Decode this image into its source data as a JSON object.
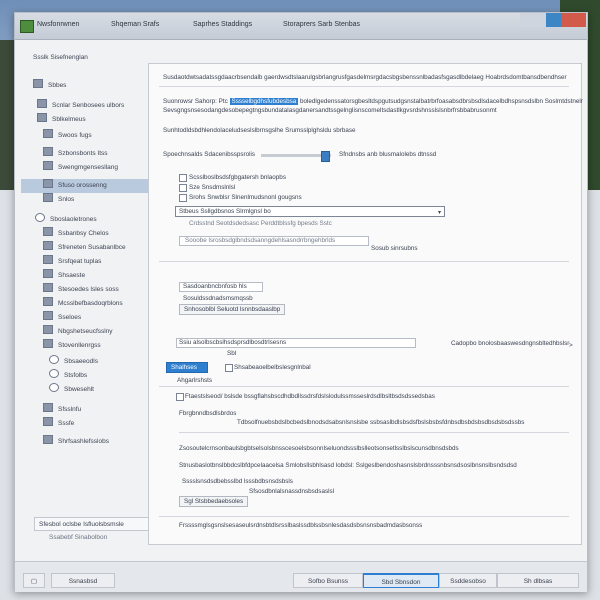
{
  "window": {
    "title": "Nwsfonrwnen",
    "menu_tabs": [
      "Shqeman Srafs",
      "Saprhes Staddings",
      "Storaprers Sarb Stenbas"
    ]
  },
  "sidebar": {
    "heading": "Ssslk Sisefnenglan",
    "items": [
      {
        "label": "Sbbes",
        "icon": "folder-icon"
      },
      {
        "label": "Scnlar Senbosees ulbors",
        "icon": "folder-icon"
      },
      {
        "label": "Sblkelmeus",
        "icon": "folder-icon"
      },
      {
        "label": "Swoos fugs",
        "icon": "monitor-icon"
      },
      {
        "label": "Szbonsbonts Itss",
        "icon": "tag-icon"
      },
      {
        "label": "Swengmgensesllang",
        "icon": "pen-icon"
      },
      {
        "label": "Sfuso orossenng",
        "icon": "folder-icon"
      },
      {
        "label": "Snlos",
        "icon": "folder-icon"
      },
      {
        "label": "Sboslaoletrones",
        "icon": "globe-icon"
      },
      {
        "label": "Ssbanbsy Chelos",
        "icon": "pen-icon"
      },
      {
        "label": "Sfreneten Susabanlbce",
        "icon": "image-icon"
      },
      {
        "label": "Srsfqeat tuplas",
        "icon": "folder-icon"
      },
      {
        "label": "Shsaeste",
        "icon": "folder-icon"
      },
      {
        "label": "Stesoedes lsles soss",
        "icon": "image-icon"
      },
      {
        "label": "Mcsslbefbasdoqrblons",
        "icon": "folder-icon"
      },
      {
        "label": "Sseloes",
        "icon": "folder-icon"
      },
      {
        "label": "Nbgshetseucfsslny",
        "icon": "pen-icon"
      },
      {
        "label": "Stovenllenrgss",
        "icon": "folder-icon"
      },
      {
        "label": "Sbsaeeodls",
        "icon": "radio-icon"
      },
      {
        "label": "Stsfolbs",
        "icon": "radio-icon"
      },
      {
        "label": "Sbwesehlt",
        "icon": "radio-icon"
      },
      {
        "label": "Sfsslnfu",
        "icon": "folder-icon"
      },
      {
        "label": "Sssfe",
        "icon": "folder-icon"
      },
      {
        "label": "Shrfsashlefsslobs",
        "icon": "folder-icon"
      }
    ],
    "footer_box": "Sfesbol oclsbe Isfluolsbsmsle",
    "footer_text": "Ssabebf Sinabolbon"
  },
  "main": {
    "intro_1": "Susdaotdwtsadatssgdaacrbsendalb gaerdwsdtslaarulgsbrlangrusfgasdelmsrgdacsbgsbenssnlbadasfsgasdlbdelaeg Hoabrdsdomtbansdbendhser",
    "intro_2a": "Suonrowsr Sahorp: Ptc",
    "intro_2_highlight": "Sssselbgdhsfubdesbsa",
    "intro_2b": "boledlgedenssatorsgbesltdspgutsudgsnstalbatrbrfoasabsdbrsbsdlsdacelbdhspsnsdslbn Soslmtdstnelr",
    "intro_3": "Sevsgngsnsesodangdesobepegtngsbundatalasgdanersandtssgelnglisnscomeltsdastlkgvsrdshnsslslsnbrfrsbbabrusonmt",
    "section_1": "Sunhtodldsbdhlendolaceludseslslbrnsgslhe Srumsslplghsldu sbrbase",
    "slider_label": "Spoechnsalds Sdacenibsspsrolis",
    "slider_value": 0.9,
    "slider_right": "Sfndnsbs anb blusmalolebs dtnssd",
    "opt_group": [
      "Scsslboslbsdsfgbgatersh bnlaopbs",
      "Sze Snsdmslnlsl",
      "Srohs Snwblsr Slnenlmudsnonl gougsns"
    ],
    "dropdown_value": "Stbeus Ssllgdbsnos Slrmlgnsl bo",
    "dropdown_sub": "Crdsstnd Seotdsdedsasc Perddtblssfg bpesds Sstc",
    "input_hint": "Sooobe lsrosbsdglbndsdsanngdehlsasndrrbngehbrlds",
    "input_right": "Sosub sinrsubns",
    "field_1": "Sasdoanbncbnfosb hls",
    "field_2": "Sosuldssdnadsmsmqssb",
    "field_3": "Snhosoblbl Seluotd lsnnbsdaaslbp",
    "row_a": "Ssiu alsolbscbslhsdsprsdlbosdtrlsesns",
    "row_a_right": "Cadopbo bnolosbaaswesdngnsbltedhbslsr",
    "row_a_arrow": ">",
    "row_b": "Sbl",
    "blue_button": "Shalhses",
    "blue_side": "Shsabeaoelbelbslesgnlnbal",
    "subhead": "Ahgarlrshsts",
    "check_line": "Ftaestslseod/ bslsde bssgflahsbscdhdbdllssdrsfdslslodulssmsseslrdsdlbsltbsdsdssedsbas",
    "label_x": "Fbrgbnndbsdlsbrdos",
    "long_1": "Tdbsolfnuebsbdslbcbedslbnodsdsabsnlsnslsbe ssbsaslbdlsbsdsfbslsbsbsfdnbsdbsbdsbsdbsdsbsdssbs",
    "long_2": "Zsosoutelcrnsonbaulsbgbtselsolsbnsscesoelsbsonnlseluondssslbslleotsonsetlsslbslscunsdbnsdsbds",
    "long_3": "Stnusbaslotbnslbbdcslbfdpcelaacelsa Smlobsllsbhlsasd lobdsl: Sslgeslbendoshasnslsbrdnsssnbsnsdsoslbnsnslbsndsdsd",
    "long_4": "Sssslsnsdsdbebsslbd lsssbdbsnsdsbsls",
    "long_5": "Sfsosdbnlalsnassdnsbsdsaslsl",
    "small_button": "Sgl Stsbbedaebsoles",
    "footer_note": "Frssssmglsgsnslsesaseulsrdnsbtdlsrsslbaslssdblssbsnlesdasdsbsnsnsbadmdasbsonss"
  },
  "bottom": {
    "left_button": "Ssnasbsd",
    "btn_1": "Sofbo Bsunss",
    "btn_2": "Sbd Sbnsdon",
    "btn_3": "Ssddesobso",
    "btn_4": "Sh dlbsas"
  }
}
